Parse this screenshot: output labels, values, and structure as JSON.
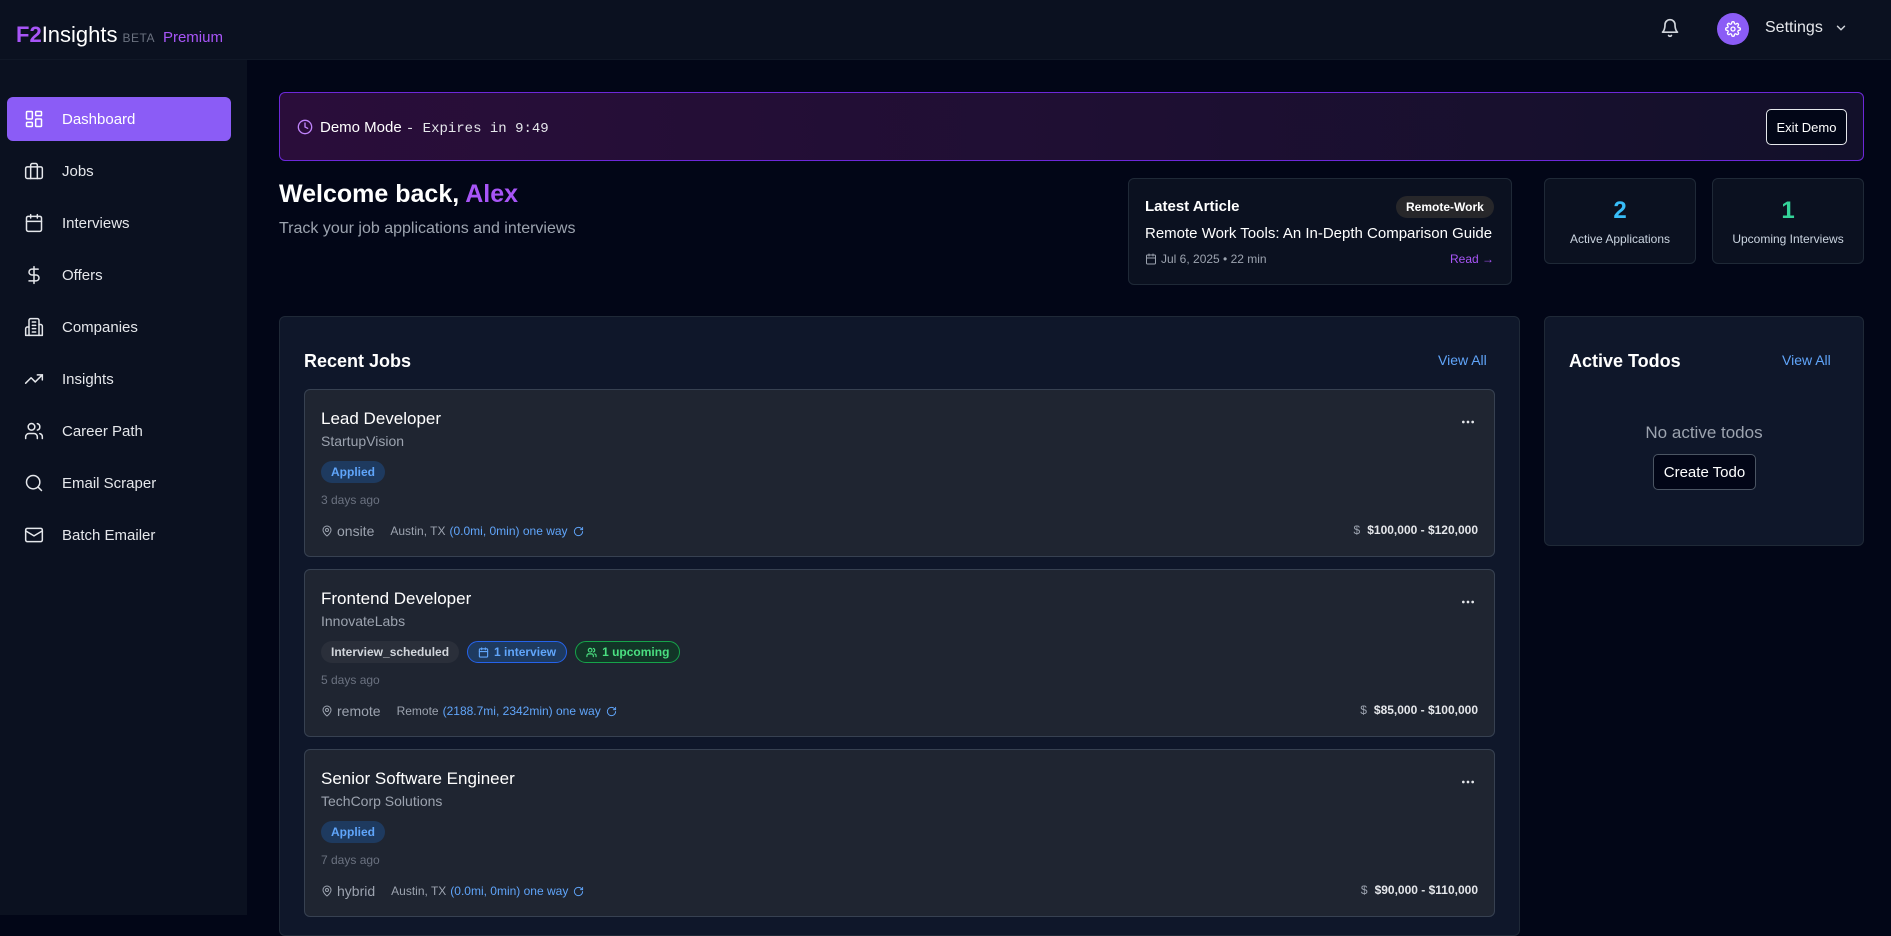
{
  "header": {
    "logo_f2": "F2",
    "logo_insights": "Insights",
    "logo_beta": "BETA",
    "logo_premium": "Premium",
    "settings_label": "Settings"
  },
  "sidebar": {
    "items": [
      {
        "label": "Dashboard",
        "icon": "dashboard-icon",
        "active": true
      },
      {
        "label": "Jobs",
        "icon": "briefcase-icon"
      },
      {
        "label": "Interviews",
        "icon": "calendar-icon"
      },
      {
        "label": "Offers",
        "icon": "dollar-icon"
      },
      {
        "label": "Companies",
        "icon": "building-icon"
      },
      {
        "label": "Insights",
        "icon": "trending-up-icon"
      },
      {
        "label": "Career Path",
        "icon": "users-icon"
      },
      {
        "label": "Email Scraper",
        "icon": "search-icon"
      },
      {
        "label": "Batch Emailer",
        "icon": "mail-icon"
      }
    ]
  },
  "demo": {
    "label": "Demo Mode",
    "expires": "- Expires in 9:49",
    "exit_label": "Exit Demo"
  },
  "welcome": {
    "prefix": "Welcome back, ",
    "name": "Alex",
    "subtitle": "Track your job applications and interviews"
  },
  "article": {
    "label": "Latest Article",
    "tag": "Remote-Work",
    "title": "Remote Work Tools: An In-Depth Comparison Guide",
    "meta": "Jul 6, 2025 • 22 min",
    "read_label": "Read →"
  },
  "stats": [
    {
      "value": "2",
      "label": "Active Applications",
      "color": "#38bdf8"
    },
    {
      "value": "1",
      "label": "Upcoming Interviews",
      "color": "#34d399"
    }
  ],
  "recent_jobs": {
    "title": "Recent Jobs",
    "view_all": "View All",
    "jobs": [
      {
        "title": "Lead Developer",
        "company": "StartupVision",
        "badges": [
          {
            "text": "Applied",
            "kind": "applied"
          }
        ],
        "ago": "3 days ago",
        "mode": "onsite",
        "location": "Austin, TX",
        "distance": "(0.0mi, 0min) one way",
        "salary": "$100,000 - $120,000"
      },
      {
        "title": "Frontend Developer",
        "company": "InnovateLabs",
        "badges": [
          {
            "text": "Interview_scheduled",
            "kind": "gray"
          },
          {
            "text": "1 interview",
            "kind": "blue"
          },
          {
            "text": "1 upcoming",
            "kind": "green"
          }
        ],
        "ago": "5 days ago",
        "mode": "remote",
        "location": "Remote",
        "distance": "(2188.7mi, 2342min) one way",
        "salary": "$85,000 - $100,000"
      },
      {
        "title": "Senior Software Engineer",
        "company": "TechCorp Solutions",
        "badges": [
          {
            "text": "Applied",
            "kind": "applied"
          }
        ],
        "ago": "7 days ago",
        "mode": "hybrid",
        "location": "Austin, TX",
        "distance": "(0.0mi, 0min) one way",
        "salary": "$90,000 - $110,000"
      }
    ]
  },
  "todos": {
    "title": "Active Todos",
    "view_all": "View All",
    "empty": "No active todos",
    "create_label": "Create Todo"
  }
}
